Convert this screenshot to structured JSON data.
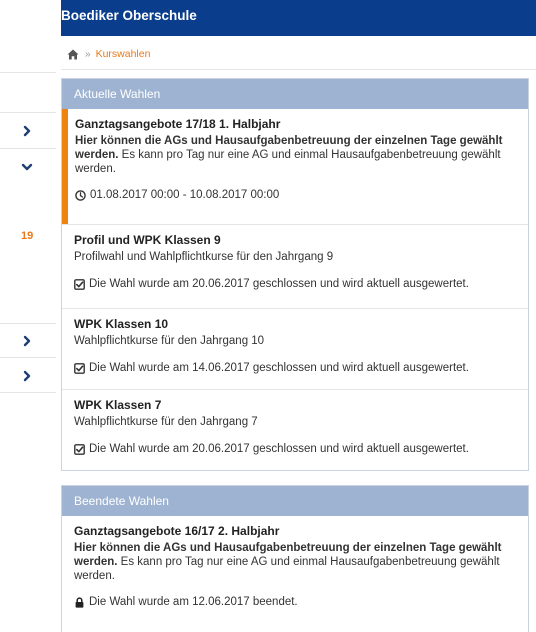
{
  "header": {
    "title": "Boediker Oberschule"
  },
  "breadcrumb": {
    "separator": "»",
    "current": "Kurswahlen"
  },
  "sidebar": {
    "badge": "19"
  },
  "panels": [
    {
      "title": "Aktuelle Wahlen",
      "items": [
        {
          "title": "Ganztagsangebote 17/18 1. Halbjahr",
          "desc_bold": "Hier können die AGs und Hausaufgabenbetreuung der einzelnen Tage gewählt werden.",
          "desc_rest": " Es kann pro Tag nur eine AG und einmal Hausaufgabenbetreuung gewählt werden.",
          "status": "01.08.2017 00:00 - 10.08.2017 00:00"
        },
        {
          "title": "Profil und WPK Klassen 9",
          "desc": "Profilwahl und Wahlpflichtkurse für den Jahrgang 9",
          "status": "Die Wahl wurde am 20.06.2017 geschlossen und wird aktuell ausgewertet."
        },
        {
          "title": "WPK Klassen 10",
          "desc": "Wahlpflichtkurse für den Jahrgang 10",
          "status": "Die Wahl wurde am 14.06.2017 geschlossen und wird aktuell ausgewertet."
        },
        {
          "title": "WPK Klassen 7",
          "desc": "Wahlpflichtkurse für den Jahrgang 7",
          "status": "Die Wahl wurde am 20.06.2017 geschlossen und wird aktuell ausgewertet."
        }
      ]
    },
    {
      "title": "Beendete Wahlen",
      "items": [
        {
          "title": "Ganztagsangebote 16/17 2. Halbjahr",
          "desc_bold": "Hier können die AGs und Hausaufgabenbetreuung der einzelnen Tage gewählt werden.",
          "desc_rest": " Es kann pro Tag nur eine AG und einmal Hausaufgabenbetreuung gewählt werden.",
          "status": "Die Wahl wurde am 12.06.2017 beendet."
        }
      ]
    }
  ],
  "icons": {
    "home": "home-icon",
    "clock": "clock-icon",
    "check": "checkbox-checked-icon",
    "lock": "lock-icon",
    "chevron_right": "chevron-right-icon",
    "chevron_down": "chevron-down-icon"
  },
  "colors": {
    "topbar": "#0a3d8c",
    "panel_header": "#9eb3d1",
    "accent": "#f0820f",
    "link": "#e87a1a"
  }
}
